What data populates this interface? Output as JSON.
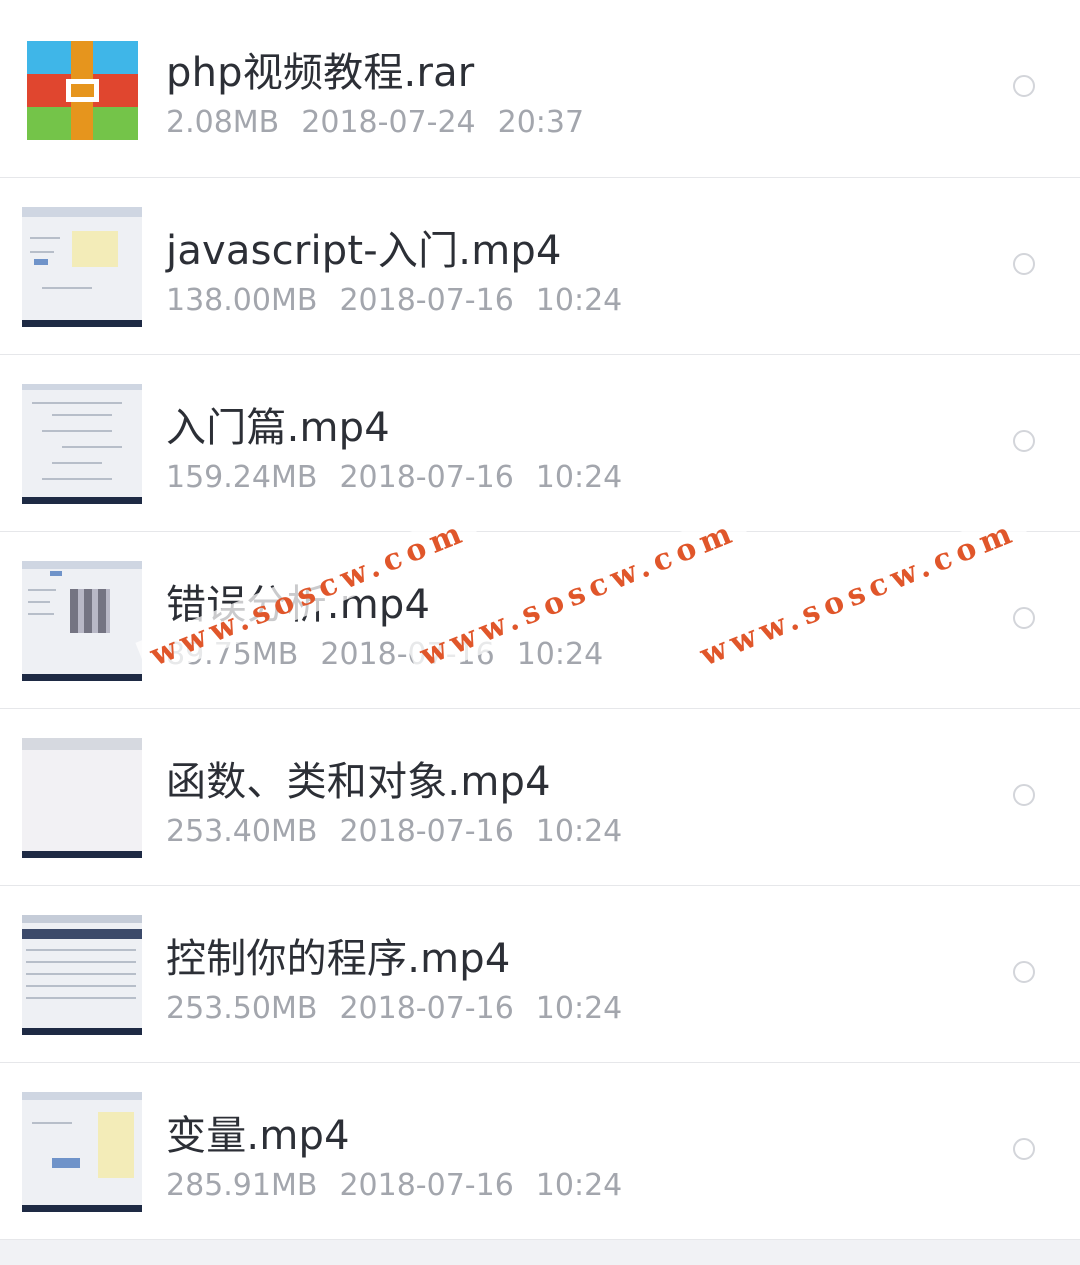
{
  "files": [
    {
      "name": "php视频教程.rar",
      "size": "2.08MB",
      "date": "2018-07-24",
      "time": "20:37",
      "type": "rar",
      "icon": "archive-icon"
    },
    {
      "name": "javascript-入门.mp4",
      "size": "138.00MB",
      "date": "2018-07-16",
      "time": "10:24",
      "type": "video",
      "icon": "video-thumbnail"
    },
    {
      "name": "入门篇.mp4",
      "size": "159.24MB",
      "date": "2018-07-16",
      "time": "10:24",
      "type": "video",
      "icon": "video-thumbnail"
    },
    {
      "name": "错误分析.mp4",
      "size": "89.75MB",
      "date": "2018-07-16",
      "time": "10:24",
      "type": "video",
      "icon": "video-thumbnail"
    },
    {
      "name": "函数、类和对象.mp4",
      "size": "253.40MB",
      "date": "2018-07-16",
      "time": "10:24",
      "type": "video",
      "icon": "video-thumbnail"
    },
    {
      "name": "控制你的程序.mp4",
      "size": "253.50MB",
      "date": "2018-07-16",
      "time": "10:24",
      "type": "video",
      "icon": "video-thumbnail"
    },
    {
      "name": "变量.mp4",
      "size": "285.91MB",
      "date": "2018-07-16",
      "time": "10:24",
      "type": "video",
      "icon": "video-thumbnail"
    }
  ],
  "watermark": "www.soscw.com",
  "colors": {
    "title": "#2c2f36",
    "meta": "#a3a6ad",
    "watermark": "#e0562a",
    "rar_blue": "#3fb6e8",
    "rar_red": "#e0462f",
    "rar_green": "#74c449",
    "rar_orange": "#e6951d"
  }
}
